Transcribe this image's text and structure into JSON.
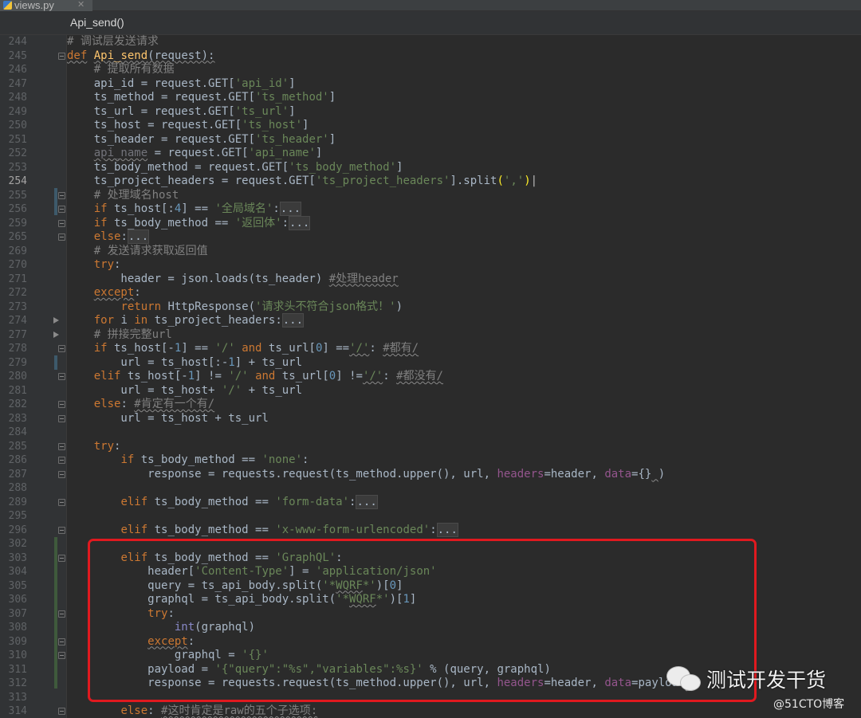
{
  "tab": {
    "label": "views.py"
  },
  "breadcrumb": {
    "label": "Api_send()"
  },
  "watermark": {
    "text": "测试开发干货",
    "sub": "@51CTO博客"
  },
  "lines": [
    {
      "n": "244",
      "fold": "",
      "html": "<span class=\"cm\"># 调试层发送请求</span>"
    },
    {
      "n": "245",
      "fold": "box",
      "html": "<span class=\"kw wavy\">def</span> <span class=\"fn wavy\">Api_send</span><span class=\"wavy\">(request):</span>"
    },
    {
      "n": "246",
      "fold": "",
      "html": "    <span class=\"cm\"># 提取所有数据</span>"
    },
    {
      "n": "247",
      "fold": "",
      "html": "    api_id = request.GET[<span class=\"str\">'api_id'</span>]"
    },
    {
      "n": "248",
      "fold": "",
      "html": "    ts_method = request.GET[<span class=\"str\">'ts_method'</span>]"
    },
    {
      "n": "249",
      "fold": "",
      "html": "    ts_url = request.GET[<span class=\"str\">'ts_url'</span>]"
    },
    {
      "n": "250",
      "fold": "",
      "html": "    ts_host = request.GET[<span class=\"str\">'ts_host'</span>]"
    },
    {
      "n": "251",
      "fold": "",
      "html": "    ts_header = request.GET[<span class=\"str\">'ts_header'</span>]"
    },
    {
      "n": "252",
      "fold": "",
      "html": "    <span class=\"unused wavy\">api_name</span> = request.GET[<span class=\"str\">'api_name'</span>]"
    },
    {
      "n": "253",
      "fold": "",
      "html": "    ts_body_method = request.GET[<span class=\"str\">'ts_body_method'</span>]"
    },
    {
      "n": "254",
      "fold": "",
      "cur": true,
      "html": "    ts_project_headers = request.GET[<span class=\"str\">'ts_project_headers'</span>].split<span class=\"brk\">(</span><span class=\"str\">','</span><span class=\"brk\">)</span><span class=\"caret\">|</span>"
    },
    {
      "n": "255",
      "fold": "box",
      "html": "    <span class=\"cm\"># 处理域名host</span>"
    },
    {
      "n": "256",
      "fold": "box",
      "html": "    <span class=\"kw\">if</span> ts_host[:<span class=\"num\">4</span>] == <span class=\"str\">'全局域名'</span>:<span class=\"folded\">...</span>"
    },
    {
      "n": "259",
      "fold": "box",
      "html": "    <span class=\"kw\">if</span> ts_body_method == <span class=\"str\">'返回体'</span>:<span class=\"folded\">...</span>"
    },
    {
      "n": "265",
      "fold": "box",
      "html": "    <span class=\"kw\">else</span>:<span class=\"folded\">...</span>"
    },
    {
      "n": "269",
      "fold": "",
      "html": "    <span class=\"cm\"># 发送请求获取返回值</span>"
    },
    {
      "n": "270",
      "fold": "",
      "html": "    <span class=\"kw\">try</span>:"
    },
    {
      "n": "271",
      "fold": "",
      "html": "        header = json.loads(ts_header) <span class=\"cm wavy\">#处理header</span>"
    },
    {
      "n": "272",
      "fold": "",
      "html": "    <span class=\"kw wavy\">except</span>:"
    },
    {
      "n": "273",
      "fold": "",
      "html": "        <span class=\"kw\">return</span> HttpResponse(<span class=\"str\">'请求头不符合json格式！'</span>)"
    },
    {
      "n": "274",
      "fold": "tri",
      "html": "    <span class=\"kw\">for</span> i <span class=\"kw\">in</span> ts_project_headers:<span class=\"folded\">...</span>"
    },
    {
      "n": "277",
      "fold": "tri",
      "html": "    <span class=\"cm\"># 拼接完整url</span>"
    },
    {
      "n": "278",
      "fold": "box",
      "html": "    <span class=\"kw\">if</span> ts_host[-<span class=\"num\">1</span>] == <span class=\"str\">'/'</span> <span class=\"kw\">and</span> ts_url[<span class=\"num\">0</span>] ==<span class=\"str wavy\">'/'</span>: <span class=\"cm wavy\">#都有/</span>"
    },
    {
      "n": "279",
      "fold": "",
      "html": "        url = ts_host[:-<span class=\"num\">1</span>] + ts_url"
    },
    {
      "n": "280",
      "fold": "box",
      "html": "    <span class=\"kw\">elif</span> ts_host[-<span class=\"num\">1</span>] != <span class=\"str\">'/'</span> <span class=\"kw\">and</span> ts_url[<span class=\"num\">0</span>] !=<span class=\"str wavy\">'/'</span>: <span class=\"cm wavy\">#都没有/</span>"
    },
    {
      "n": "281",
      "fold": "",
      "html": "        url = ts_host+ <span class=\"str\">'/'</span> + ts_url"
    },
    {
      "n": "282",
      "fold": "box",
      "html": "    <span class=\"kw\">else</span>: <span class=\"cm wavy\">#肯定有一个有/</span>"
    },
    {
      "n": "283",
      "fold": "box",
      "html": "        url = ts_host + ts_url"
    },
    {
      "n": "284",
      "fold": "",
      "html": ""
    },
    {
      "n": "285",
      "fold": "box",
      "html": "    <span class=\"kw\">try</span>:"
    },
    {
      "n": "286",
      "fold": "box",
      "html": "        <span class=\"kw\">if</span> ts_body_method == <span class=\"str\">'none'</span>:"
    },
    {
      "n": "287",
      "fold": "box",
      "html": "            response = requests.request(ts_method.upper(), url, <span class=\"par\">headers</span>=header, <span class=\"par\">data</span>={}<span class=\"wavy\"> </span>)"
    },
    {
      "n": "288",
      "fold": "",
      "html": ""
    },
    {
      "n": "289",
      "fold": "box",
      "html": "        <span class=\"kw\">elif</span> ts_body_method == <span class=\"str\">'form-data'</span>:<span class=\"folded\">...</span>"
    },
    {
      "n": "295",
      "fold": "",
      "html": ""
    },
    {
      "n": "296",
      "fold": "box",
      "html": "        <span class=\"kw\">elif</span> ts_body_method == <span class=\"str\">'x-www-form-urlencoded'</span>:<span class=\"folded\">...</span>"
    },
    {
      "n": "302",
      "fold": "",
      "html": ""
    },
    {
      "n": "303",
      "fold": "box",
      "html": "        <span class=\"kw\">elif</span> ts_body_method == <span class=\"str\">'GraphQL'</span>:"
    },
    {
      "n": "304",
      "fold": "",
      "html": "            header[<span class=\"str\">'Content-Type'</span>] = <span class=\"str\">'application/json'</span>"
    },
    {
      "n": "305",
      "fold": "",
      "html": "            query = ts_api_body.split(<span class=\"str\">'*<span class=\"wavy\">WQRF</span>*'</span>)[<span class=\"num\">0</span>]"
    },
    {
      "n": "306",
      "fold": "",
      "html": "            graphql = ts_api_body.split(<span class=\"str\">'*<span class=\"wavy\">WQRF</span>*'</span>)[<span class=\"num\">1</span>]"
    },
    {
      "n": "307",
      "fold": "box",
      "html": "            <span class=\"kw\">try</span>:"
    },
    {
      "n": "308",
      "fold": "",
      "html": "                <span class=\"bi\">int</span>(graphql)"
    },
    {
      "n": "309",
      "fold": "box",
      "html": "            <span class=\"kw wavy\">except</span>:"
    },
    {
      "n": "310",
      "fold": "box",
      "html": "                graphql = <span class=\"str\">'{}'</span>"
    },
    {
      "n": "311",
      "fold": "",
      "html": "            payload = <span class=\"str\">'{\"query\":\"%s\",\"variables\":%s}'</span> % (query, graphql)"
    },
    {
      "n": "312",
      "fold": "",
      "html": "            response = requests.request(ts_method.upper(), url, <span class=\"par\">headers</span>=header, <span class=\"par\">data</span>=payload<span class=\"wavy\"> </span>)"
    },
    {
      "n": "313",
      "fold": "",
      "html": ""
    },
    {
      "n": "314",
      "fold": "box",
      "html": "        <span class=\"kw\">else</span>: <span class=\"cm wavy\">#这时肯定是raw的五个子选项:</span>"
    }
  ]
}
